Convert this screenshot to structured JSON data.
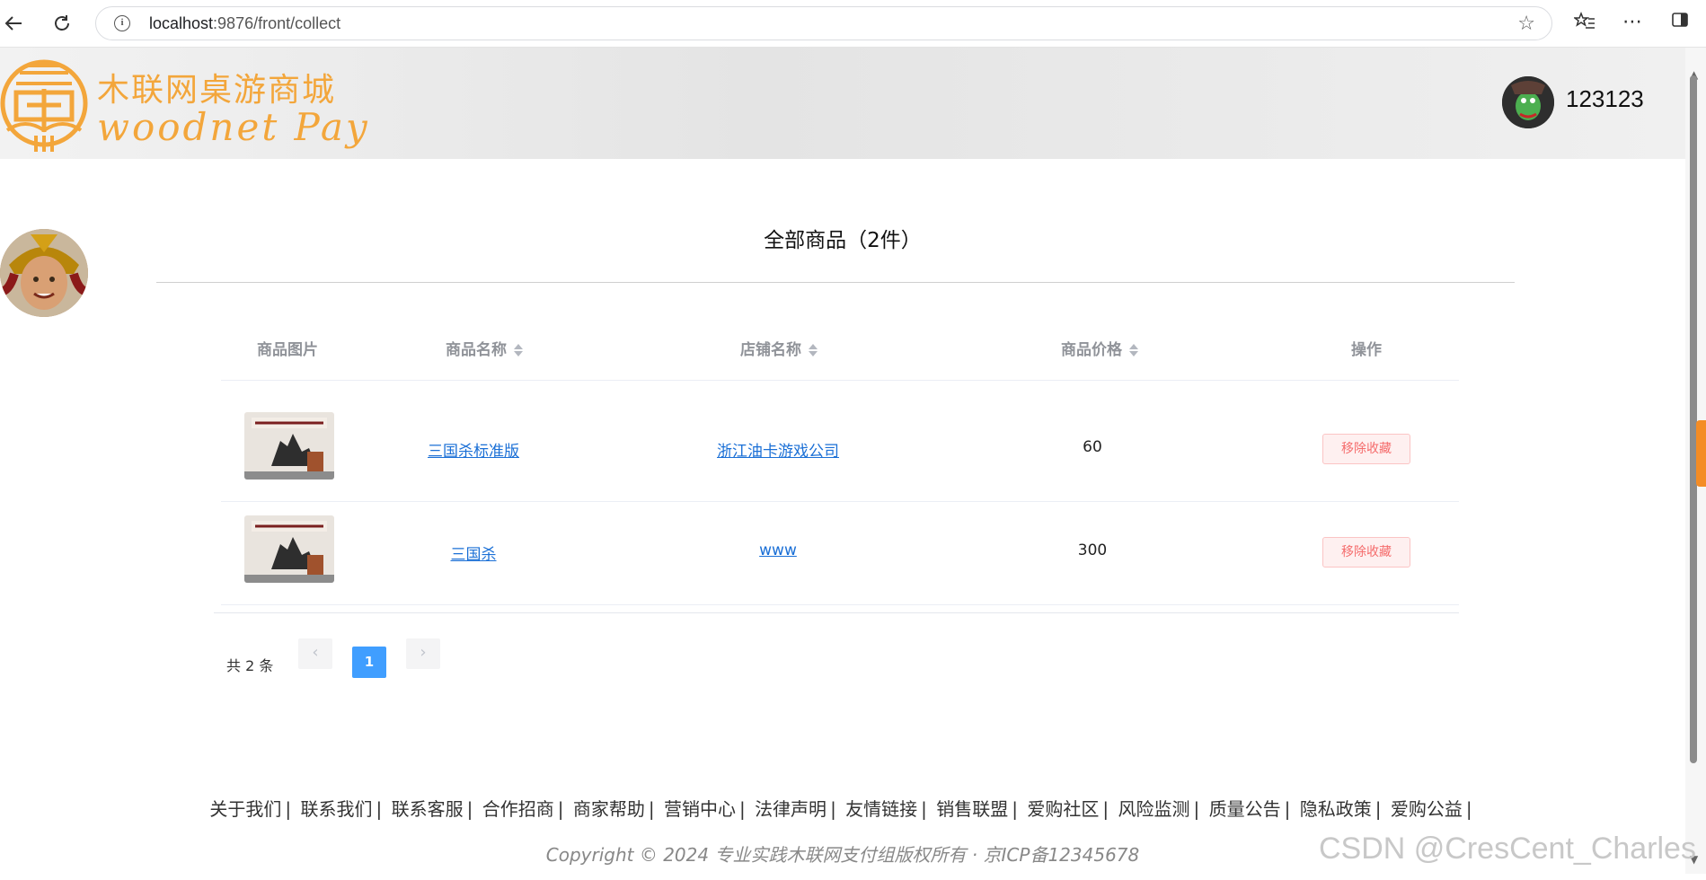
{
  "browser": {
    "url_host": "localhost",
    "url_path": ":9876/front/collect"
  },
  "header": {
    "brand_cn": "木联网桌游商城",
    "brand_en": "woodnet Pay",
    "username": "123123"
  },
  "main": {
    "title": "全部商品（2件）",
    "columns": [
      "商品图片",
      "商品名称",
      "店铺名称",
      "商品价格",
      "操作"
    ],
    "rows": [
      {
        "name": "三国杀标准版",
        "shop": "浙江油卡游戏公司",
        "price": "60",
        "action": "移除收藏"
      },
      {
        "name": "三国杀",
        "shop": "www",
        "price": "300",
        "action": "移除收藏"
      }
    ]
  },
  "pagination": {
    "total": "共 2 条",
    "prev": "‹",
    "current": "1",
    "next": "›"
  },
  "footer": {
    "links": [
      "关于我们",
      "联系我们",
      "联系客服",
      "合作招商",
      "商家帮助",
      "营销中心",
      "法律声明",
      "友情链接",
      "销售联盟",
      "爱购社区",
      "风险监测",
      "质量公告",
      "隐私政策",
      "爱购公益"
    ],
    "copyright": "Copyright © 2024 专业实践木联网支付组版权所有 · 京ICP备12345678"
  },
  "watermark": "CSDN @CresCent_Charles",
  "colors": {
    "brand": "#f3a63b",
    "link": "#1a6fd6",
    "pager_active": "#409eff",
    "danger": "#f56c6c"
  }
}
